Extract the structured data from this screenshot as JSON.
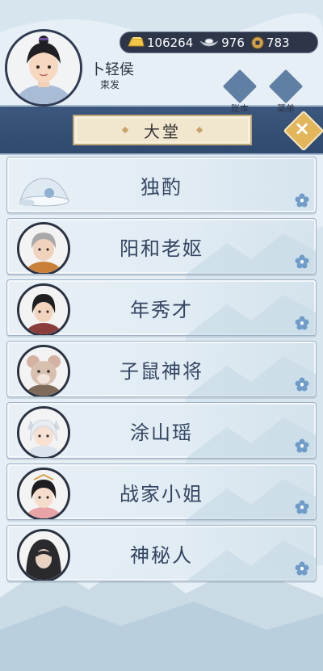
{
  "player": {
    "name": "卜轻侯",
    "title": "束发"
  },
  "resources": {
    "gold": "106264",
    "silver": "976",
    "coin": "783"
  },
  "header_buttons": {
    "ledger": "账本",
    "menu": "菜单"
  },
  "screen_title": "大堂",
  "characters": [
    {
      "name": "独酌"
    },
    {
      "name": "阳和老妪"
    },
    {
      "name": "年秀才"
    },
    {
      "name": "子鼠神将"
    },
    {
      "name": "涂山瑶"
    },
    {
      "name": "战家小姐"
    },
    {
      "name": "神秘人"
    }
  ],
  "colors": {
    "band": "#2f4a6e",
    "text": "#334562",
    "accent": "#e3b65c"
  }
}
